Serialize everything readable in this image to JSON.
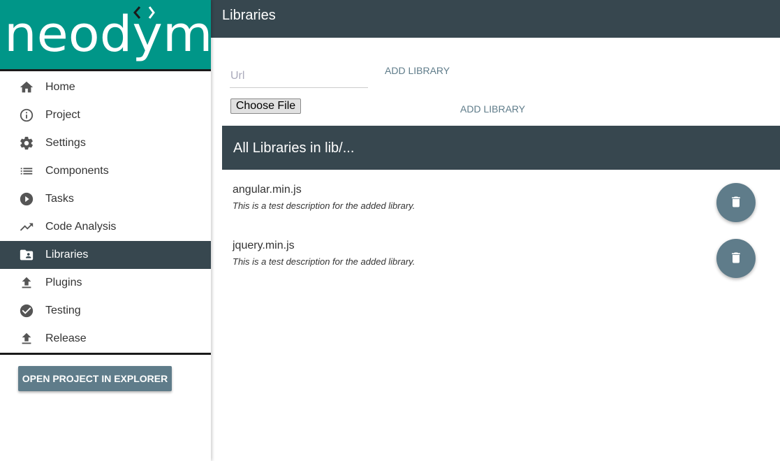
{
  "app": {
    "logo_text": "neodym",
    "brand_color": "#009688",
    "header_color": "#37474f",
    "accent_color": "#5f7c8a"
  },
  "topbar": {
    "title": "Libraries"
  },
  "sidebar": {
    "items": [
      {
        "label": "Home",
        "icon": "home-icon"
      },
      {
        "label": "Project",
        "icon": "info-icon"
      },
      {
        "label": "Settings",
        "icon": "gear-icon"
      },
      {
        "label": "Components",
        "icon": "list-icon"
      },
      {
        "label": "Tasks",
        "icon": "play-circle-icon"
      },
      {
        "label": "Code Analysis",
        "icon": "trending-up-icon"
      },
      {
        "label": "Libraries",
        "icon": "folder-user-icon",
        "active": true
      },
      {
        "label": "Plugins",
        "icon": "upload-icon"
      },
      {
        "label": "Testing",
        "icon": "check-circle-icon"
      },
      {
        "label": "Release",
        "icon": "upload-icon"
      }
    ],
    "open_button": "OPEN PROJECT IN EXPLORER"
  },
  "add_form": {
    "url_placeholder": "Url",
    "url_value": "",
    "add_url_label": "ADD LIBRARY",
    "choose_file_label": "Choose File",
    "add_file_label": "ADD LIBRARY"
  },
  "libraries": {
    "header": "All Libraries in lib/...",
    "items": [
      {
        "name": "angular.min.js",
        "description": "This is a test description for the added library."
      },
      {
        "name": "jquery.min.js",
        "description": "This is a test description for the added library."
      }
    ]
  }
}
